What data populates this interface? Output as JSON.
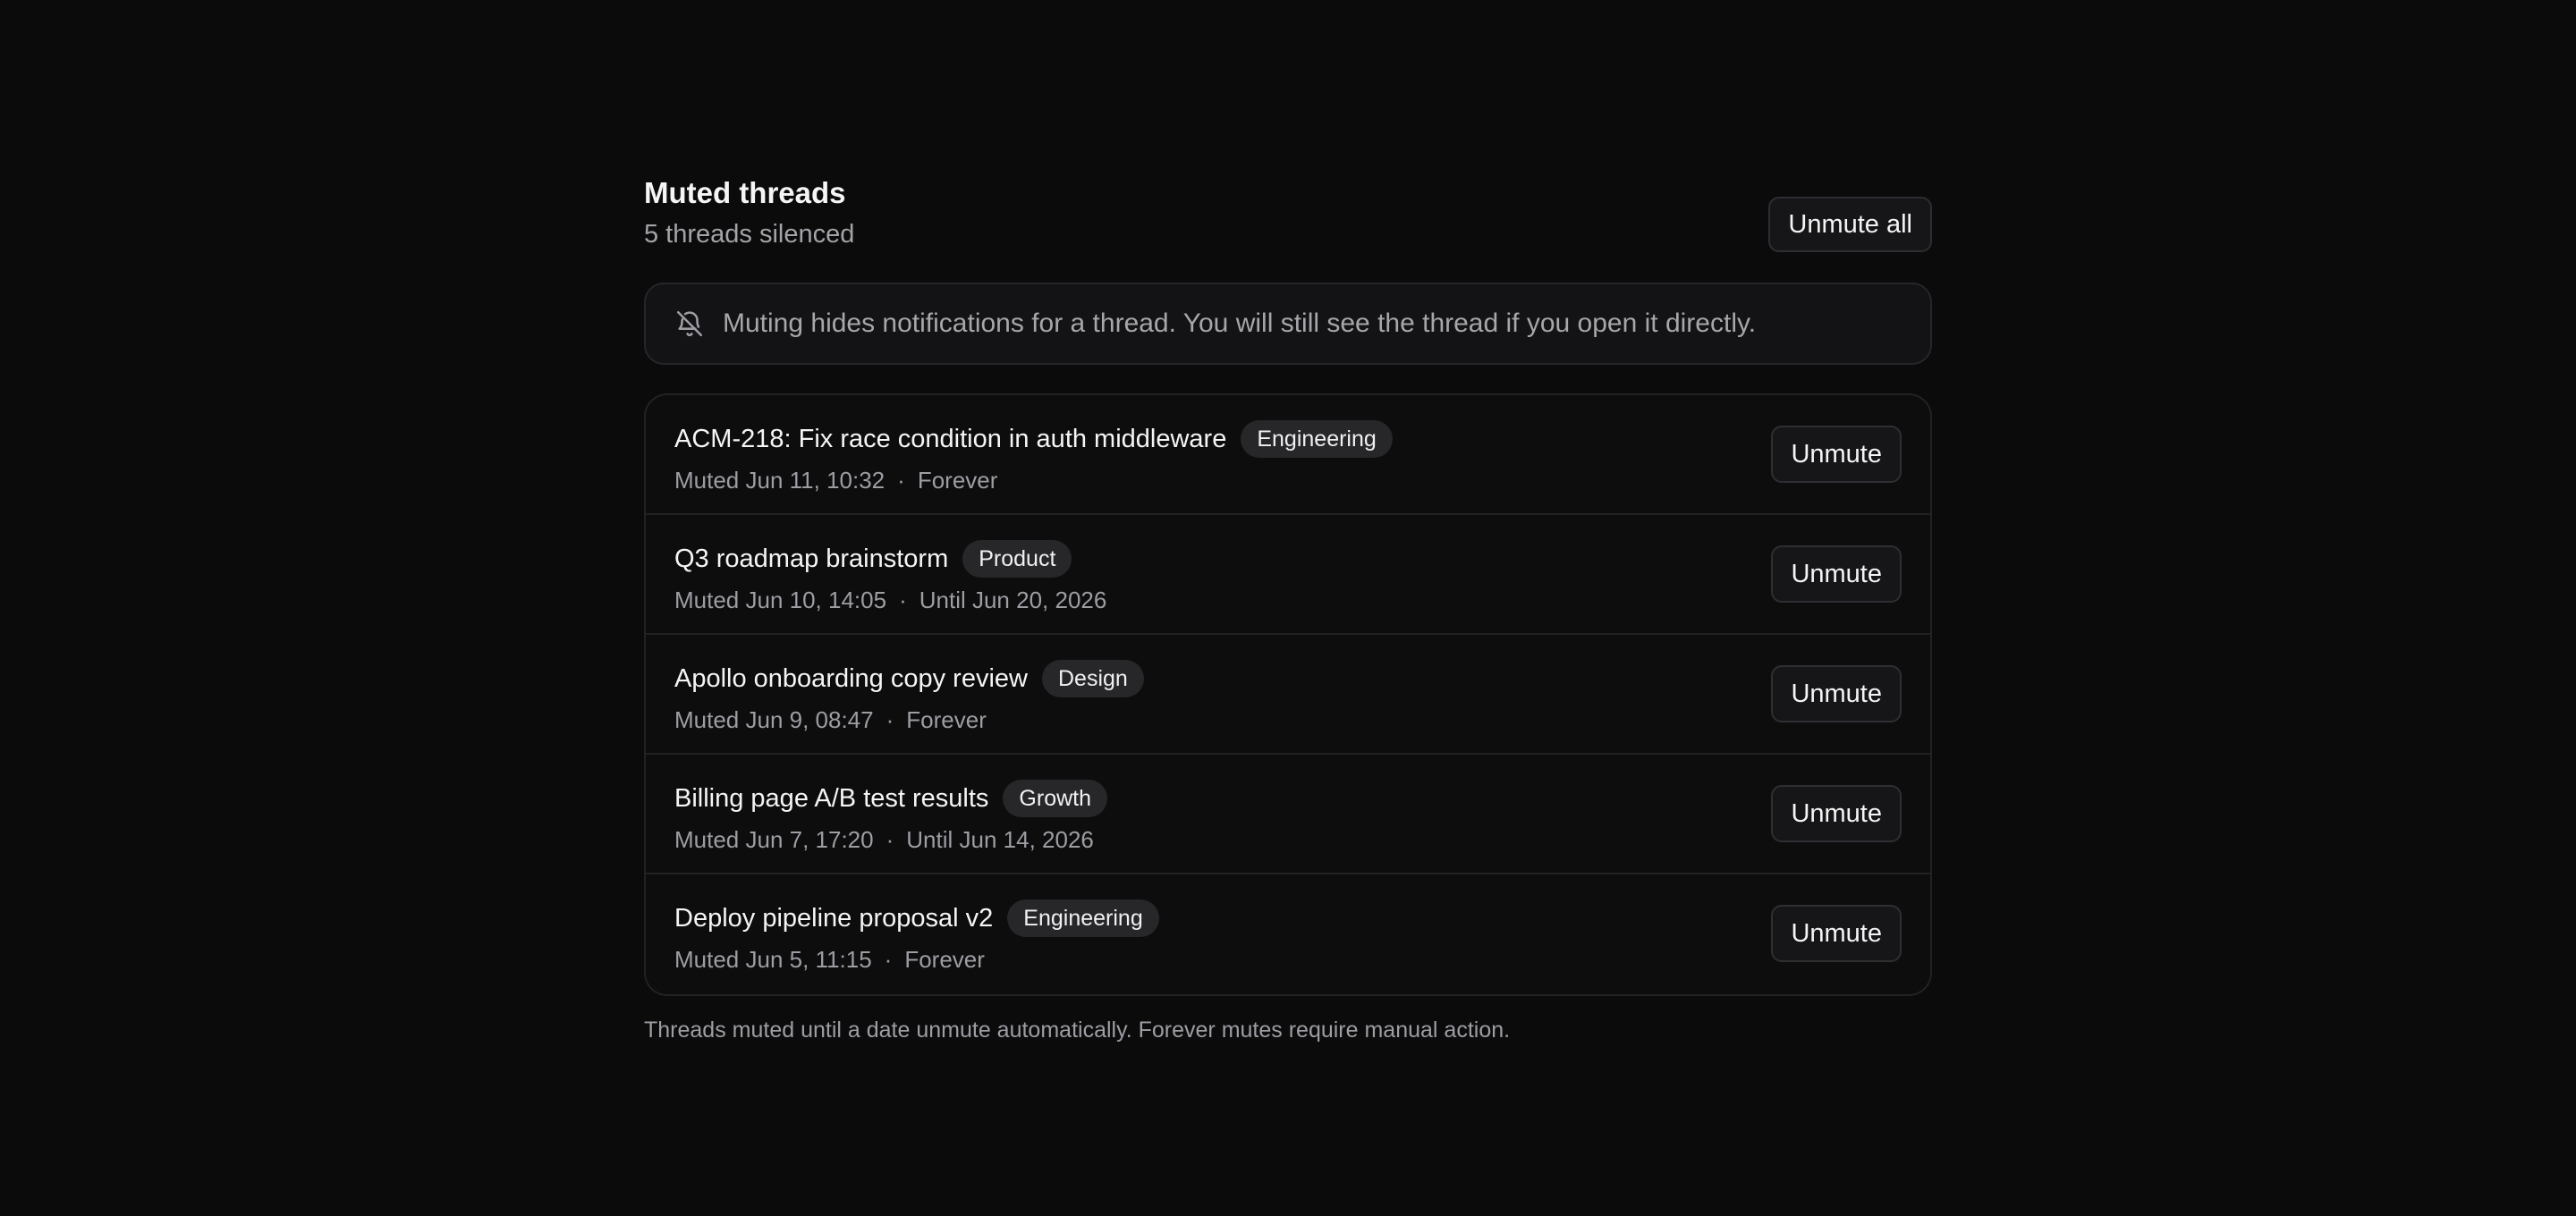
{
  "header": {
    "title": "Muted threads",
    "subtitle": "5 threads silenced",
    "unmute_all_label": "Unmute all"
  },
  "notice": {
    "icon": "bell-off-icon",
    "text": "Muting hides notifications for a thread. You will still see the thread if you open it directly."
  },
  "threads": [
    {
      "name": "ACM-218: Fix race condition in auth middleware",
      "tag": "Engineering",
      "muted_at": "Muted Jun 11, 10:32",
      "duration": "Forever",
      "action_label": "Unmute"
    },
    {
      "name": "Q3 roadmap brainstorm",
      "tag": "Product",
      "muted_at": "Muted Jun 10, 14:05",
      "duration": "Until Jun 20, 2026",
      "action_label": "Unmute"
    },
    {
      "name": "Apollo onboarding copy review",
      "tag": "Design",
      "muted_at": "Muted Jun 9, 08:47",
      "duration": "Forever",
      "action_label": "Unmute"
    },
    {
      "name": "Billing page A/B test results",
      "tag": "Growth",
      "muted_at": "Muted Jun 7, 17:20",
      "duration": "Until Jun 14, 2026",
      "action_label": "Unmute"
    },
    {
      "name": "Deploy pipeline proposal v2",
      "tag": "Engineering",
      "muted_at": "Muted Jun 5, 11:15",
      "duration": "Forever",
      "action_label": "Unmute"
    }
  ],
  "meta_separator": "·",
  "footer": {
    "note": "Threads muted until a date unmute automatically. Forever mutes require manual action."
  }
}
